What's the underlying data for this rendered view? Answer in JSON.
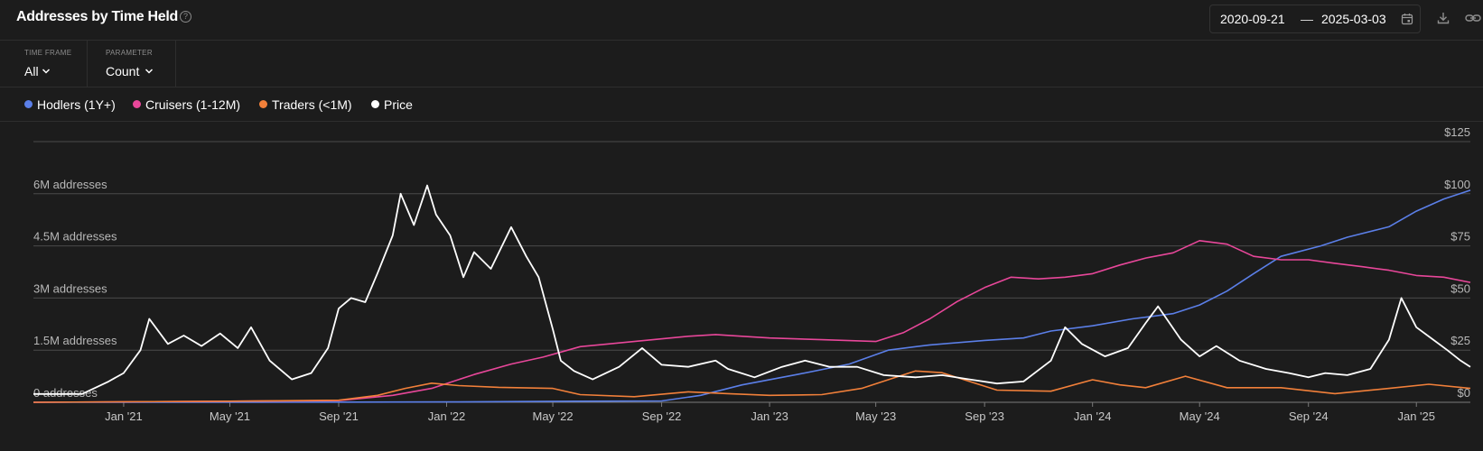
{
  "header": {
    "title": "Addresses by Time Held",
    "date_start": "2020-09-21",
    "date_sep": "—",
    "date_end": "2025-03-03"
  },
  "controls": {
    "timeframe_caption": "TIME FRAME",
    "timeframe_value": "All",
    "parameter_caption": "PARAMETER",
    "parameter_value": "Count"
  },
  "legend": [
    {
      "label": "Hodlers (1Y+)",
      "color": "#5b7fe8"
    },
    {
      "label": "Cruisers (1-12M)",
      "color": "#e8479a"
    },
    {
      "label": "Traders (<1M)",
      "color": "#f2803a"
    },
    {
      "label": "Price",
      "color": "#ffffff"
    }
  ],
  "chart_data": {
    "type": "line",
    "x_start": "2020-09-21",
    "x_end": "2025-03-03",
    "x_ticks": [
      {
        "label": "Jan '21",
        "date": "2021-01-01"
      },
      {
        "label": "May '21",
        "date": "2021-05-01"
      },
      {
        "label": "Sep '21",
        "date": "2021-09-01"
      },
      {
        "label": "Jan '22",
        "date": "2022-01-01"
      },
      {
        "label": "May '22",
        "date": "2022-05-01"
      },
      {
        "label": "Sep '22",
        "date": "2022-09-01"
      },
      {
        "label": "Jan '23",
        "date": "2023-01-01"
      },
      {
        "label": "May '23",
        "date": "2023-05-01"
      },
      {
        "label": "Sep '23",
        "date": "2023-09-01"
      },
      {
        "label": "Jan '24",
        "date": "2024-01-01"
      },
      {
        "label": "May '24",
        "date": "2024-05-01"
      },
      {
        "label": "Sep '24",
        "date": "2024-09-01"
      },
      {
        "label": "Jan '25",
        "date": "2025-01-01"
      }
    ],
    "y_left": {
      "min": 0,
      "max": 7500000,
      "ticks": [
        {
          "value": 0,
          "label": "0 addresses"
        },
        {
          "value": 1500000,
          "label": "1.5M addresses"
        },
        {
          "value": 3000000,
          "label": "3M addresses"
        },
        {
          "value": 4500000,
          "label": "4.5M addresses"
        },
        {
          "value": 6000000,
          "label": "6M addresses"
        }
      ]
    },
    "y_right": {
      "min": 0,
      "max": 125,
      "ticks": [
        {
          "value": 0,
          "label": "$0"
        },
        {
          "value": 25,
          "label": "$25"
        },
        {
          "value": 50,
          "label": "$50"
        },
        {
          "value": 75,
          "label": "$75"
        },
        {
          "value": 100,
          "label": "$100"
        },
        {
          "value": 125,
          "label": "$125"
        }
      ]
    },
    "grid": true,
    "series": [
      {
        "name": "Hodlers (1Y+)",
        "axis": "left",
        "color": "#5b7fe8",
        "points": [
          [
            "2020-09-21",
            0
          ],
          [
            "2021-06-01",
            0
          ],
          [
            "2022-01-01",
            10000
          ],
          [
            "2022-06-01",
            30000
          ],
          [
            "2022-09-01",
            40000
          ],
          [
            "2022-10-15",
            200000
          ],
          [
            "2022-12-01",
            500000
          ],
          [
            "2023-02-01",
            800000
          ],
          [
            "2023-04-01",
            1100000
          ],
          [
            "2023-05-15",
            1500000
          ],
          [
            "2023-07-01",
            1650000
          ],
          [
            "2023-09-01",
            1780000
          ],
          [
            "2023-10-15",
            1850000
          ],
          [
            "2023-11-15",
            2050000
          ],
          [
            "2024-01-01",
            2200000
          ],
          [
            "2024-02-15",
            2400000
          ],
          [
            "2024-04-01",
            2550000
          ],
          [
            "2024-05-01",
            2800000
          ],
          [
            "2024-06-01",
            3200000
          ],
          [
            "2024-07-01",
            3700000
          ],
          [
            "2024-08-01",
            4200000
          ],
          [
            "2024-09-15",
            4500000
          ],
          [
            "2024-10-15",
            4750000
          ],
          [
            "2024-12-01",
            5050000
          ],
          [
            "2025-01-01",
            5500000
          ],
          [
            "2025-02-01",
            5850000
          ],
          [
            "2025-03-03",
            6100000
          ]
        ]
      },
      {
        "name": "Cruisers (1-12M)",
        "axis": "left",
        "color": "#e8479a",
        "points": [
          [
            "2020-09-21",
            0
          ],
          [
            "2021-05-01",
            30000
          ],
          [
            "2021-09-01",
            50000
          ],
          [
            "2021-11-01",
            200000
          ],
          [
            "2021-12-15",
            400000
          ],
          [
            "2022-02-01",
            800000
          ],
          [
            "2022-03-15",
            1100000
          ],
          [
            "2022-04-20",
            1300000
          ],
          [
            "2022-06-01",
            1600000
          ],
          [
            "2022-08-01",
            1750000
          ],
          [
            "2022-10-01",
            1900000
          ],
          [
            "2022-11-01",
            1950000
          ],
          [
            "2022-12-01",
            1900000
          ],
          [
            "2023-01-01",
            1850000
          ],
          [
            "2023-03-01",
            1800000
          ],
          [
            "2023-05-01",
            1750000
          ],
          [
            "2023-06-01",
            2000000
          ],
          [
            "2023-07-01",
            2400000
          ],
          [
            "2023-08-01",
            2900000
          ],
          [
            "2023-09-01",
            3300000
          ],
          [
            "2023-10-01",
            3600000
          ],
          [
            "2023-11-01",
            3550000
          ],
          [
            "2023-12-01",
            3600000
          ],
          [
            "2024-01-01",
            3700000
          ],
          [
            "2024-02-01",
            3950000
          ],
          [
            "2024-03-01",
            4150000
          ],
          [
            "2024-04-01",
            4300000
          ],
          [
            "2024-05-01",
            4650000
          ],
          [
            "2024-06-01",
            4550000
          ],
          [
            "2024-07-01",
            4200000
          ],
          [
            "2024-08-01",
            4100000
          ],
          [
            "2024-09-01",
            4100000
          ],
          [
            "2024-10-01",
            4000000
          ],
          [
            "2024-11-01",
            3900000
          ],
          [
            "2024-12-01",
            3800000
          ],
          [
            "2025-01-01",
            3650000
          ],
          [
            "2025-02-01",
            3600000
          ],
          [
            "2025-03-03",
            3450000
          ]
        ]
      },
      {
        "name": "Traders (<1M)",
        "axis": "left",
        "color": "#f2803a",
        "points": [
          [
            "2020-09-21",
            0
          ],
          [
            "2021-05-01",
            30000
          ],
          [
            "2021-09-01",
            60000
          ],
          [
            "2021-10-15",
            200000
          ],
          [
            "2021-11-15",
            400000
          ],
          [
            "2021-12-15",
            550000
          ],
          [
            "2022-01-15",
            480000
          ],
          [
            "2022-03-01",
            430000
          ],
          [
            "2022-05-01",
            400000
          ],
          [
            "2022-06-01",
            220000
          ],
          [
            "2022-08-01",
            160000
          ],
          [
            "2022-10-01",
            300000
          ],
          [
            "2022-11-15",
            250000
          ],
          [
            "2023-01-01",
            200000
          ],
          [
            "2023-03-01",
            220000
          ],
          [
            "2023-04-15",
            400000
          ],
          [
            "2023-05-15",
            650000
          ],
          [
            "2023-06-15",
            900000
          ],
          [
            "2023-07-15",
            850000
          ],
          [
            "2023-08-15",
            600000
          ],
          [
            "2023-09-15",
            350000
          ],
          [
            "2023-11-15",
            320000
          ],
          [
            "2024-01-01",
            650000
          ],
          [
            "2024-02-01",
            500000
          ],
          [
            "2024-03-01",
            420000
          ],
          [
            "2024-04-15",
            750000
          ],
          [
            "2024-06-01",
            420000
          ],
          [
            "2024-08-01",
            420000
          ],
          [
            "2024-10-01",
            250000
          ],
          [
            "2024-12-01",
            400000
          ],
          [
            "2025-01-15",
            520000
          ],
          [
            "2025-03-03",
            400000
          ]
        ]
      },
      {
        "name": "Price",
        "axis": "right",
        "color": "#ffffff",
        "points": [
          [
            "2020-09-21",
            4
          ],
          [
            "2020-11-15",
            4
          ],
          [
            "2020-12-15",
            10
          ],
          [
            "2021-01-01",
            14
          ],
          [
            "2021-01-20",
            25
          ],
          [
            "2021-01-30",
            40
          ],
          [
            "2021-02-20",
            28
          ],
          [
            "2021-03-10",
            32
          ],
          [
            "2021-03-30",
            27
          ],
          [
            "2021-04-20",
            33
          ],
          [
            "2021-05-10",
            26
          ],
          [
            "2021-05-25",
            36
          ],
          [
            "2021-06-15",
            20
          ],
          [
            "2021-07-10",
            11
          ],
          [
            "2021-08-01",
            14
          ],
          [
            "2021-08-20",
            26
          ],
          [
            "2021-09-01",
            45
          ],
          [
            "2021-09-15",
            50
          ],
          [
            "2021-10-01",
            48
          ],
          [
            "2021-10-15",
            62
          ],
          [
            "2021-11-01",
            80
          ],
          [
            "2021-11-10",
            100
          ],
          [
            "2021-11-25",
            85
          ],
          [
            "2021-12-10",
            104
          ],
          [
            "2021-12-20",
            90
          ],
          [
            "2022-01-05",
            80
          ],
          [
            "2022-01-20",
            60
          ],
          [
            "2022-02-01",
            72
          ],
          [
            "2022-02-20",
            64
          ],
          [
            "2022-03-15",
            84
          ],
          [
            "2022-04-01",
            70
          ],
          [
            "2022-04-15",
            60
          ],
          [
            "2022-05-01",
            35
          ],
          [
            "2022-05-10",
            20
          ],
          [
            "2022-05-25",
            15
          ],
          [
            "2022-06-15",
            11
          ],
          [
            "2022-07-15",
            17
          ],
          [
            "2022-08-10",
            26
          ],
          [
            "2022-09-01",
            18
          ],
          [
            "2022-10-01",
            17
          ],
          [
            "2022-11-01",
            20
          ],
          [
            "2022-11-15",
            16
          ],
          [
            "2022-12-15",
            12
          ],
          [
            "2023-01-15",
            17
          ],
          [
            "2023-02-10",
            20
          ],
          [
            "2023-03-10",
            17
          ],
          [
            "2023-04-10",
            17
          ],
          [
            "2023-05-10",
            13
          ],
          [
            "2023-06-15",
            12
          ],
          [
            "2023-07-15",
            13
          ],
          [
            "2023-08-15",
            11
          ],
          [
            "2023-09-15",
            9
          ],
          [
            "2023-10-15",
            10
          ],
          [
            "2023-11-15",
            20
          ],
          [
            "2023-12-01",
            36
          ],
          [
            "2023-12-20",
            28
          ],
          [
            "2024-01-15",
            22
          ],
          [
            "2024-02-10",
            26
          ],
          [
            "2024-03-01",
            38
          ],
          [
            "2024-03-15",
            46
          ],
          [
            "2024-04-10",
            30
          ],
          [
            "2024-05-01",
            22
          ],
          [
            "2024-05-20",
            27
          ],
          [
            "2024-06-15",
            20
          ],
          [
            "2024-07-15",
            16
          ],
          [
            "2024-08-10",
            14
          ],
          [
            "2024-09-01",
            12
          ],
          [
            "2024-09-20",
            14
          ],
          [
            "2024-10-15",
            13
          ],
          [
            "2024-11-10",
            16
          ],
          [
            "2024-12-01",
            30
          ],
          [
            "2024-12-15",
            50
          ],
          [
            "2025-01-01",
            36
          ],
          [
            "2025-01-20",
            30
          ],
          [
            "2025-02-05",
            25
          ],
          [
            "2025-02-20",
            20
          ],
          [
            "2025-03-03",
            17
          ]
        ]
      }
    ]
  }
}
